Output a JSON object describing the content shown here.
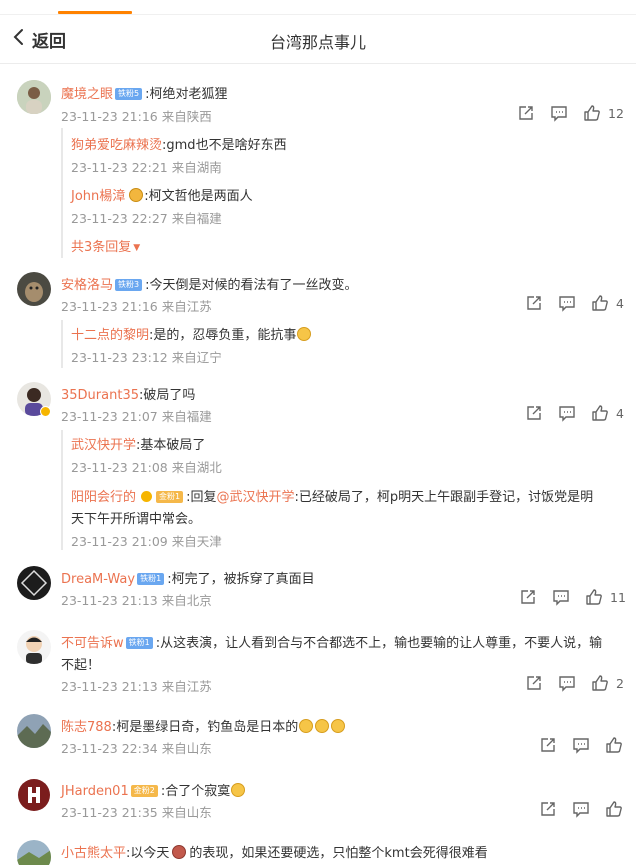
{
  "header": {
    "back_label": "返回",
    "title": "台湾那点事儿"
  },
  "comments": [
    {
      "user": "魔境之眼",
      "badge": "铁粉5",
      "text": ":柯绝对老狐狸",
      "meta": "23-11-23 21:16 来自陕西",
      "likes": "12",
      "replies": [
        {
          "user": "狗弟爱吃麻辣烫",
          "text": ":gmd也不是啥好东西",
          "meta": "23-11-23 22:21 来自湖南"
        },
        {
          "user": "John楊漳",
          "text": ":柯文哲他是两面人",
          "meta": "23-11-23 22:27 来自福建"
        }
      ],
      "more": "共3条回复"
    },
    {
      "user": "安格洛马",
      "badge": "铁粉3",
      "text": ":今天倒是对候的看法有了一丝改变。",
      "meta": "23-11-23 21:16 来自江苏",
      "likes": "4",
      "replies": [
        {
          "user": "十二点的黎明",
          "text": ":是的，忍辱负重，能抗事",
          "meta": "23-11-23 23:12 来自辽宁"
        }
      ]
    },
    {
      "user": "35Durant35",
      "text": ":破局了吗",
      "meta": "23-11-23 21:07 来自福建",
      "likes": "4",
      "replies": [
        {
          "user": "武汉快开学",
          "text": ":基本破局了",
          "meta": "23-11-23 21:08 来自湖北"
        },
        {
          "user": "阳阳会行的",
          "badge": "金粉1",
          "text_prefix": ":回复",
          "mention": "@武汉快开学",
          "text": ":已经破局了，柯p明天上午跟副手登记，讨饭党是明",
          "text2": "天下午开所谓中常会。",
          "meta": "23-11-23 21:09 来自天津"
        }
      ]
    },
    {
      "user": "DreaM-Way",
      "badge": "铁粉1",
      "text": ":柯完了，被拆穿了真面目",
      "meta": "23-11-23 21:13 来自北京",
      "likes": "11"
    },
    {
      "user": "不可告诉w",
      "badge": "铁粉1",
      "text": ":从这表演，让人看到合与不合都选不上，输也要输的让人尊重，不要人说，输",
      "text2": "不起！",
      "meta": "23-11-23 21:13 来自江苏",
      "likes": "2"
    },
    {
      "user": "陈志788",
      "text": ":柯是墨绿日奇，钓鱼岛是日本的",
      "meta": "23-11-23 22:34 来自山东"
    },
    {
      "user": "JHarden01",
      "badge": "金粉2",
      "text": ":合了个寂寞",
      "meta": "23-11-23 21:35 来自山东"
    },
    {
      "user": "小古熊太平",
      "text_a": ":以今天",
      "text_b": "的表现，如果还要硬选，只怕整个kmt会死得很难看"
    }
  ],
  "colors": {
    "accent": "#ff8200",
    "username": "#eb7350",
    "meta": "#999999",
    "badge_blue": "#6aa7f0",
    "badge_gold": "#f5b84a"
  },
  "icons": [
    "chevron-left-icon",
    "share-icon",
    "comment-icon",
    "like-icon"
  ]
}
